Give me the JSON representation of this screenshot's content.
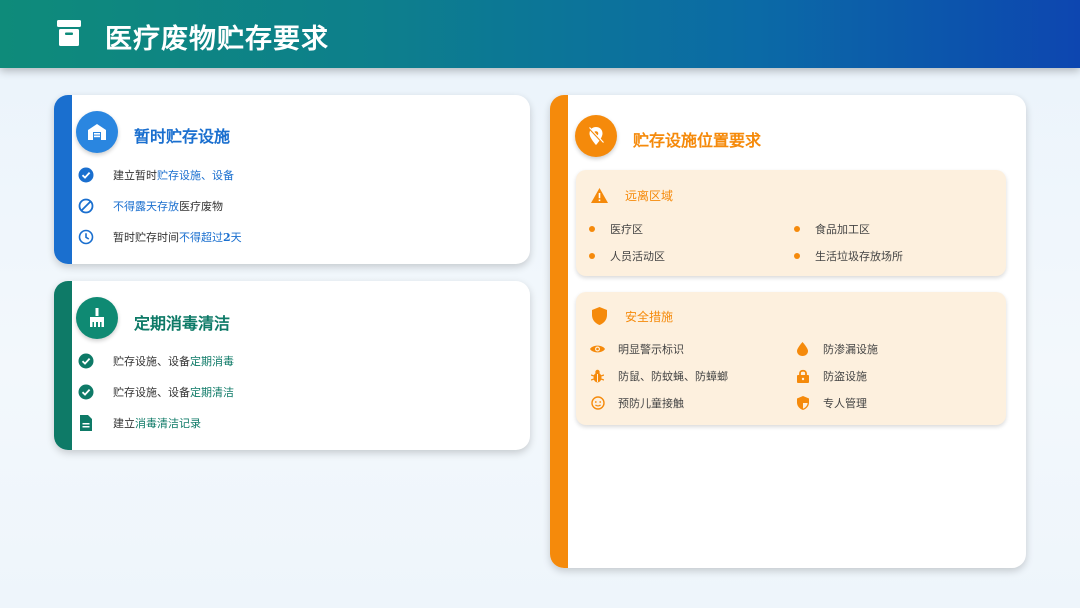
{
  "header": {
    "title": "医疗废物贮存要求",
    "icon": "archive-icon"
  },
  "card1": {
    "title": "暂时贮存设施",
    "icon": "warehouse-icon",
    "rows": [
      {
        "icon": "check-circle-icon",
        "pre": "建立暂时",
        "hl": "贮存设施、设备",
        "post": ""
      },
      {
        "icon": "prohibited-icon",
        "pre": "",
        "hl": "不得露天存放",
        "post": "医疗废物"
      },
      {
        "icon": "clock-icon",
        "pre": "暂时贮存时间",
        "hl": "不得超过",
        "bold": "2",
        "post": "天"
      }
    ]
  },
  "card2": {
    "title": "定期消毒清洁",
    "icon": "broom-icon",
    "rows": [
      {
        "icon": "check-circle-icon",
        "pre": "贮存设施、设备",
        "hl": "定期消毒"
      },
      {
        "icon": "check-circle-icon",
        "pre": "贮存设施、设备",
        "hl": "定期清洁"
      },
      {
        "icon": "document-icon",
        "pre": "建立",
        "hl": "消毒清洁记录"
      }
    ]
  },
  "card3": {
    "title": "贮存设施位置要求",
    "icon": "location-off-icon",
    "section1": {
      "title": "远离区域",
      "icon": "warning-icon",
      "items": [
        "医疗区",
        "食品加工区",
        "人员活动区",
        "生活垃圾存放场所"
      ]
    },
    "section2": {
      "title": "安全措施",
      "icon": "shield-icon",
      "items": [
        {
          "icon": "eye-icon",
          "label": "明显警示标识"
        },
        {
          "icon": "drop-icon",
          "label": "防渗漏设施"
        },
        {
          "icon": "bug-icon",
          "label": "防鼠、防蚊蝇、防蟑螂"
        },
        {
          "icon": "lock-icon",
          "label": "防盗设施"
        },
        {
          "icon": "child-icon",
          "label": "预防儿童接触"
        },
        {
          "icon": "security-badge-icon",
          "label": "专人管理"
        }
      ]
    }
  },
  "colors": {
    "blue": "#1a6fcf",
    "green": "#0e7a67",
    "orange": "#f58a0b",
    "panel": "#fdf0de"
  }
}
